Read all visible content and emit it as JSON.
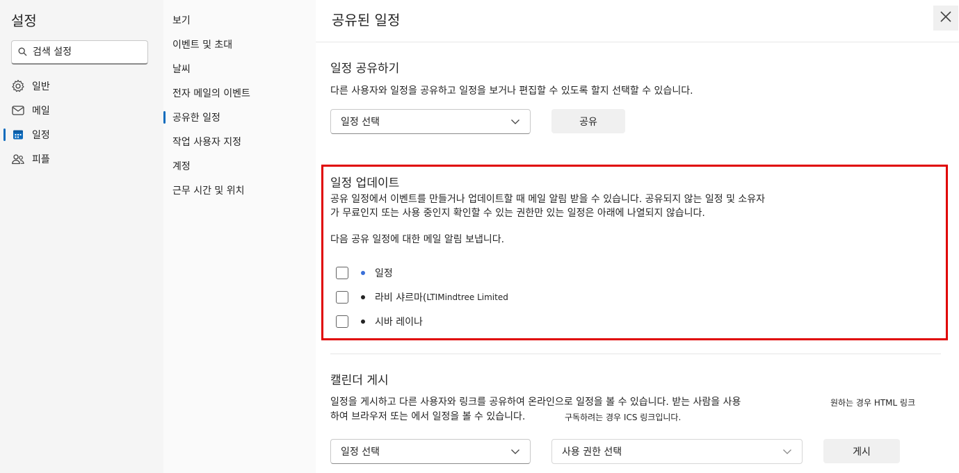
{
  "settings": {
    "title": "설정",
    "search": {
      "placeholder": "검색 설정",
      "icon": "search-icon"
    },
    "nav": [
      {
        "label": "일반",
        "icon": "gear-icon"
      },
      {
        "label": "메일",
        "icon": "mail-icon"
      },
      {
        "label": "일정",
        "icon": "calendar-icon",
        "selected": true
      },
      {
        "label": "피플",
        "icon": "people-icon"
      }
    ]
  },
  "calendar_nav": [
    {
      "label": "보기"
    },
    {
      "label": "이벤트 및 초대"
    },
    {
      "label": "날씨"
    },
    {
      "label": "전자 메일의 이벤트"
    },
    {
      "label": "공유한 일정",
      "selected": true
    },
    {
      "label": "작업 사용자 지정"
    },
    {
      "label": "계정"
    },
    {
      "label": "근무 시간 및 위치"
    }
  ],
  "content": {
    "title": "공유된 일정",
    "share": {
      "heading": "일정 공유하기",
      "desc": "다른 사용자와 일정을 공유하고 일정을 보거나 편집할 수 있도록 할지 선택할 수 있습니다.",
      "select_value": "일정 선택",
      "button": "공유"
    },
    "updates": {
      "heading": "일정 업데이트",
      "desc_line1": "공유 일정에서 이벤트를 만들거나 업데이트할 때 메일 알림 받을 수 있습니다. 공유되지 않는 일정 및 소유자",
      "desc_line2": "가 무료인지 또는 사용 중인지 확인할 수 있는 권한만 있는 일정은 아래에 나열되지 않습니다.",
      "prompt": "다음 공유 일정에 대한 메일 알림 보냅니다.",
      "items": [
        {
          "label": "일정",
          "dot_color": "#3a6fd8",
          "checked": false
        },
        {
          "label_ko": "라비 샤르마(",
          "label_en": "LTIMindtree Limited",
          "dot_color": "#242424",
          "checked": false
        },
        {
          "label": "시바 레이나",
          "dot_color": "#242424",
          "checked": false
        }
      ]
    },
    "publish": {
      "heading": "캘린더 게시",
      "desc_line1": "일정을 게시하고 다른 사용자와 링크를 공유하여 온라인으로 일정을 볼 수 있습니다. 받는 사람을 사용",
      "desc_line1_extra": "원하는 경우 HTML 링크",
      "desc_line2": "하여 브라우저 또는 에서 일정을 볼 수 있습니다.",
      "desc_line2_extra": "구독하려는 경우 ICS 링크입니다.",
      "calendar_select": "일정 선택",
      "permission_select": "사용 권한 선택",
      "button": "게시"
    }
  },
  "colors": {
    "accent": "#0f6cbd",
    "highlight": "#e00000"
  }
}
